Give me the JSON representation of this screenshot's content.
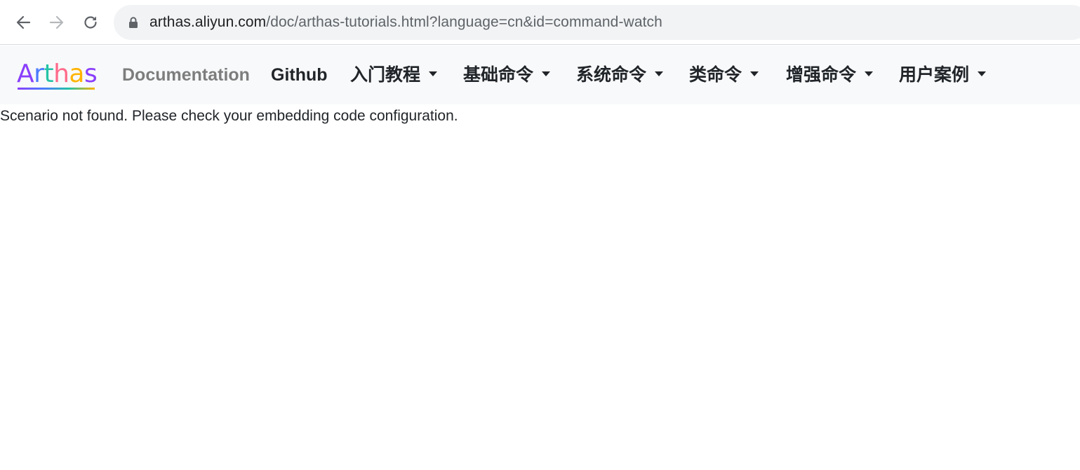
{
  "browser": {
    "url_host": "arthas.aliyun.com",
    "url_path": "/doc/arthas-tutorials.html?language=cn&id=command-watch",
    "back_icon": "arrow-left-icon",
    "forward_icon": "arrow-right-icon",
    "reload_icon": "reload-icon",
    "lock_icon": "lock-icon"
  },
  "navbar": {
    "brand": "Arthas",
    "brand_colors": [
      "#8a3ffc",
      "#4c7bff",
      "#23c3a6",
      "#ff6a8a",
      "#ffb400"
    ],
    "documentation": "Documentation",
    "github": "Github",
    "menus": [
      {
        "label": "入门教程"
      },
      {
        "label": "基础命令"
      },
      {
        "label": "系统命令"
      },
      {
        "label": "类命令"
      },
      {
        "label": "增强命令"
      },
      {
        "label": "用户案例"
      }
    ]
  },
  "content": {
    "message": "Scenario not found. Please check your embedding code configuration."
  }
}
